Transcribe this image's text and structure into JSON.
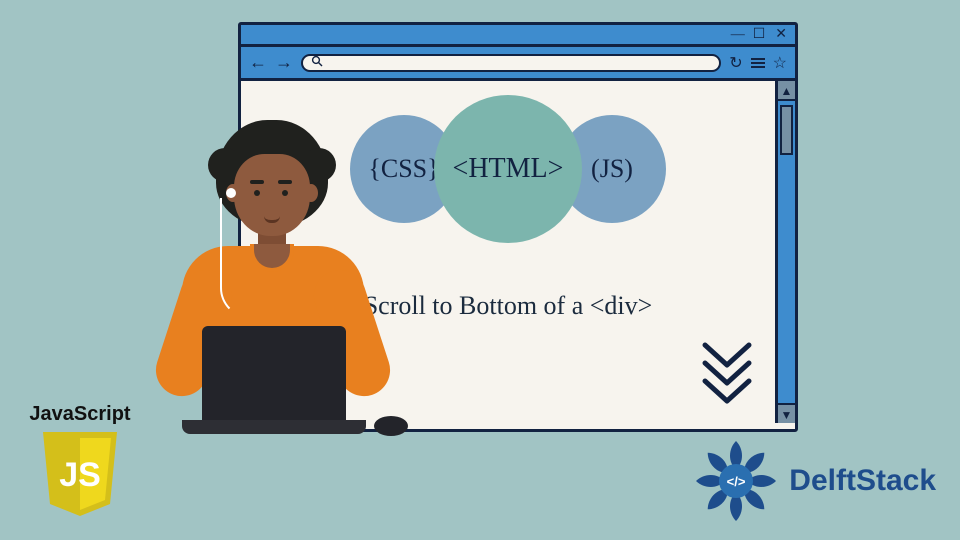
{
  "browser": {
    "window_controls": {
      "minimize": "—",
      "maximize": "☐",
      "close": "✕"
    },
    "toolbar": {
      "back": "←",
      "forward": "→",
      "search_icon": "search",
      "search_value": "",
      "refresh": "↻",
      "menu": "≡",
      "favorite": "☆"
    },
    "scrollbar": {
      "up": "▲",
      "down": "▼"
    }
  },
  "bubbles": {
    "css": "{CSS}",
    "html": "<HTML>",
    "js": "(JS)"
  },
  "headline": "Scroll to Bottom of a <div>",
  "chevron_icon": "double-chevron-down",
  "js_badge": {
    "label": "JavaScript",
    "initials": "JS"
  },
  "delftstack": {
    "name": "DelftStack",
    "tag": "</>"
  },
  "colors": {
    "bg": "#a1c4c4",
    "browser_chrome": "#3e8cce",
    "outline": "#122241",
    "bubble_side": "#7ba2c2",
    "bubble_mid": "#7cb5ad",
    "shirt": "#e8801f",
    "js_yellow": "#efd81d",
    "delft_blue": "#1e4d8c"
  }
}
